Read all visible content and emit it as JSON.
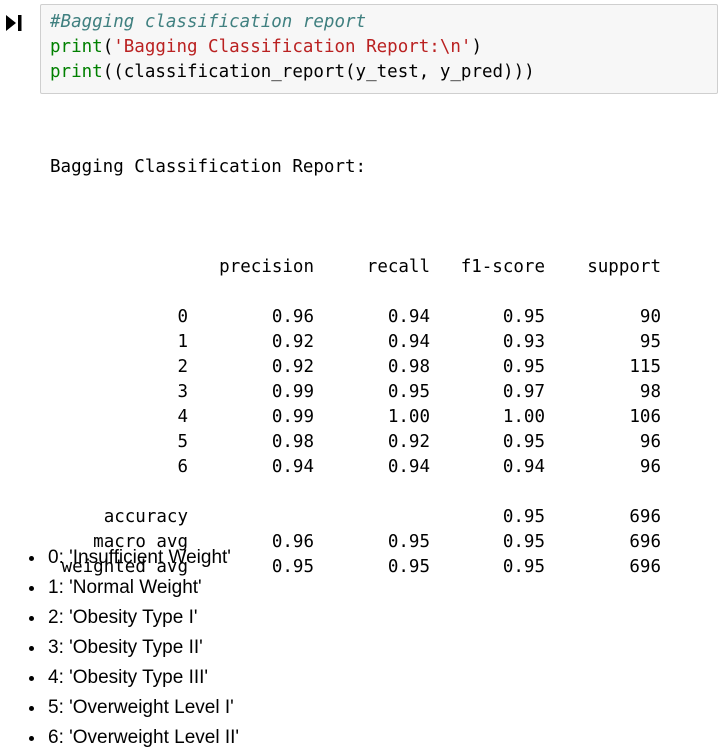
{
  "code_cell": {
    "line1": "#Bagging classification report",
    "line2": {
      "fn": "print",
      "open": "(",
      "string": "'Bagging Classification Report:\\n'",
      "close": ")"
    },
    "line3": {
      "fn1": "print",
      "mid": "((classification_report(y_test, y_pred)))"
    }
  },
  "output": {
    "title": "Bagging Classification Report:",
    "headers": [
      "",
      "precision",
      "recall",
      "f1-score",
      "support"
    ],
    "class_rows": [
      [
        "0",
        "0.96",
        "0.94",
        "0.95",
        "90"
      ],
      [
        "1",
        "0.92",
        "0.94",
        "0.93",
        "95"
      ],
      [
        "2",
        "0.92",
        "0.98",
        "0.95",
        "115"
      ],
      [
        "3",
        "0.99",
        "0.95",
        "0.97",
        "98"
      ],
      [
        "4",
        "0.99",
        "1.00",
        "1.00",
        "106"
      ],
      [
        "5",
        "0.98",
        "0.92",
        "0.95",
        "96"
      ],
      [
        "6",
        "0.94",
        "0.94",
        "0.94",
        "96"
      ]
    ],
    "summary_rows": [
      [
        "accuracy",
        "",
        "",
        "0.95",
        "696"
      ],
      [
        "macro avg",
        "0.96",
        "0.95",
        "0.95",
        "696"
      ],
      [
        "weighted avg",
        "0.95",
        "0.95",
        "0.95",
        "696"
      ]
    ]
  },
  "class_mapping": [
    "0: 'Insufficient Weight'",
    "1: 'Normal Weight'",
    "2: 'Obesity Type I'",
    "3: 'Obesity Type II'",
    "4: 'Obesity Type III'",
    "5: 'Overweight Level I'",
    "6: 'Overweight Level II'"
  ],
  "icons": {
    "run": "run-step-icon"
  },
  "colors": {
    "comment": "#408080",
    "builtin": "#008000",
    "string": "#ba2121",
    "cell_background": "#f7f7f7",
    "cell_border": "#cfcfcf"
  }
}
